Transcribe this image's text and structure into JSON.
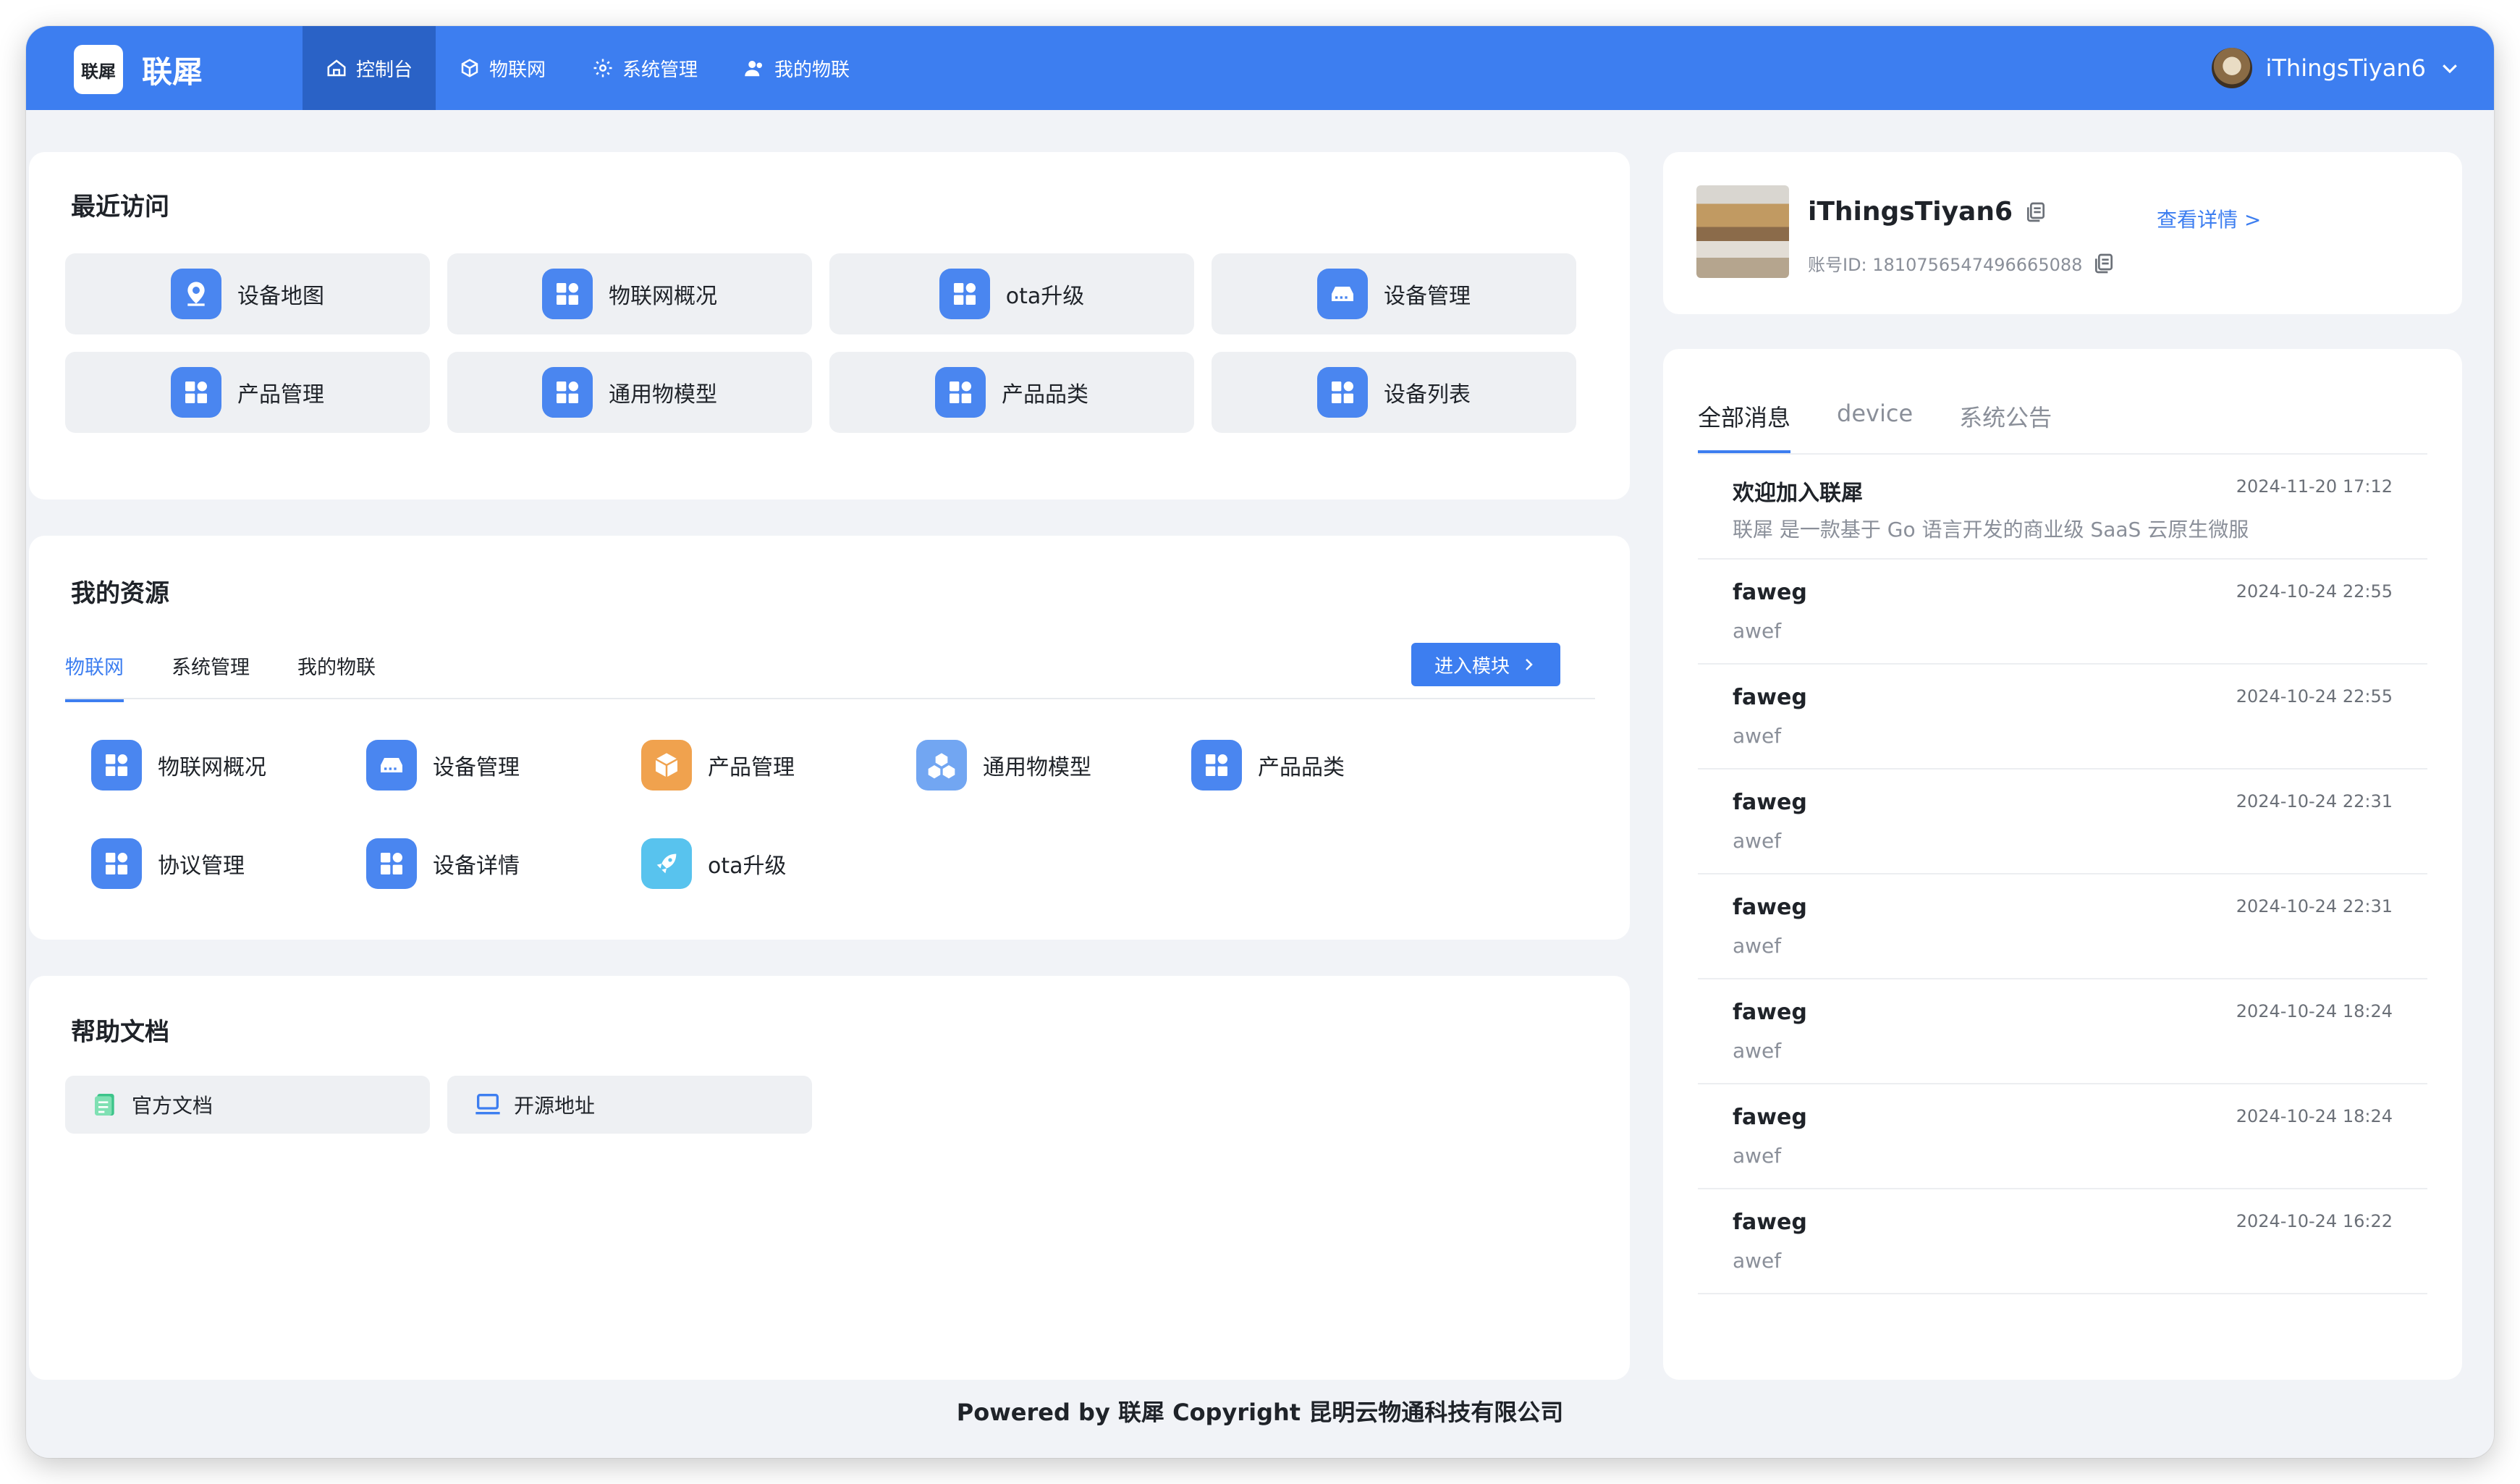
{
  "header": {
    "logo_text": "联犀",
    "brand": "联犀",
    "nav": [
      {
        "label": "控制台",
        "icon": "home-icon"
      },
      {
        "label": "物联网",
        "icon": "cube-icon"
      },
      {
        "label": "系统管理",
        "icon": "gear-icon"
      },
      {
        "label": "我的物联",
        "icon": "users-icon"
      }
    ],
    "username": "iThingsTiyan6"
  },
  "recent": {
    "title": "最近访问",
    "items": [
      {
        "label": "设备地图",
        "icon": "map-pin-icon"
      },
      {
        "label": "物联网概况",
        "icon": "grid-icon"
      },
      {
        "label": "ota升级",
        "icon": "grid-icon"
      },
      {
        "label": "设备管理",
        "icon": "device-icon"
      },
      {
        "label": "产品管理",
        "icon": "grid-icon"
      },
      {
        "label": "通用物模型",
        "icon": "grid-icon"
      },
      {
        "label": "产品品类",
        "icon": "grid-icon"
      },
      {
        "label": "设备列表",
        "icon": "grid-icon"
      }
    ]
  },
  "resources": {
    "title": "我的资源",
    "tabs": [
      "物联网",
      "系统管理",
      "我的物联"
    ],
    "enter_button": "进入模块",
    "items": [
      {
        "label": "物联网概况",
        "icon": "grid-icon"
      },
      {
        "label": "设备管理",
        "icon": "device-icon"
      },
      {
        "label": "产品管理",
        "icon": "box-icon"
      },
      {
        "label": "通用物模型",
        "icon": "cubes-icon"
      },
      {
        "label": "产品品类",
        "icon": "grid-icon"
      },
      {
        "label": "协议管理",
        "icon": "grid-icon"
      },
      {
        "label": "设备详情",
        "icon": "grid-icon"
      },
      {
        "label": "ota升级",
        "icon": "rocket-icon"
      }
    ]
  },
  "help": {
    "title": "帮助文档",
    "items": [
      {
        "label": "官方文档",
        "icon": "document-icon"
      },
      {
        "label": "开源地址",
        "icon": "laptop-icon"
      }
    ]
  },
  "profile": {
    "name": "iThingsTiyan6",
    "account_id": "账号ID: 1810756547496665088",
    "details_link": "查看详情 >"
  },
  "messages": {
    "tabs": [
      "全部消息",
      "device",
      "系统公告"
    ],
    "items": [
      {
        "title": "欢迎加入联犀",
        "time": "2024-11-20 17:12",
        "body": "联犀 是一款基于 Go 语言开发的商业级 SaaS 云原生微服"
      },
      {
        "title": "faweg",
        "time": "2024-10-24 22:55",
        "body": "awef"
      },
      {
        "title": "faweg",
        "time": "2024-10-24 22:55",
        "body": "awef"
      },
      {
        "title": "faweg",
        "time": "2024-10-24 22:31",
        "body": "awef"
      },
      {
        "title": "faweg",
        "time": "2024-10-24 22:31",
        "body": "awef"
      },
      {
        "title": "faweg",
        "time": "2024-10-24 18:24",
        "body": "awef"
      },
      {
        "title": "faweg",
        "time": "2024-10-24 18:24",
        "body": "awef"
      },
      {
        "title": "faweg",
        "time": "2024-10-24 16:22",
        "body": "awef"
      }
    ]
  },
  "footer": "Powered by 联犀 Copyright 昆明云物通科技有限公司",
  "colors": {
    "primary": "#3d7ef0",
    "nav_active": "#2a62c6",
    "background": "#f1f3f7"
  }
}
